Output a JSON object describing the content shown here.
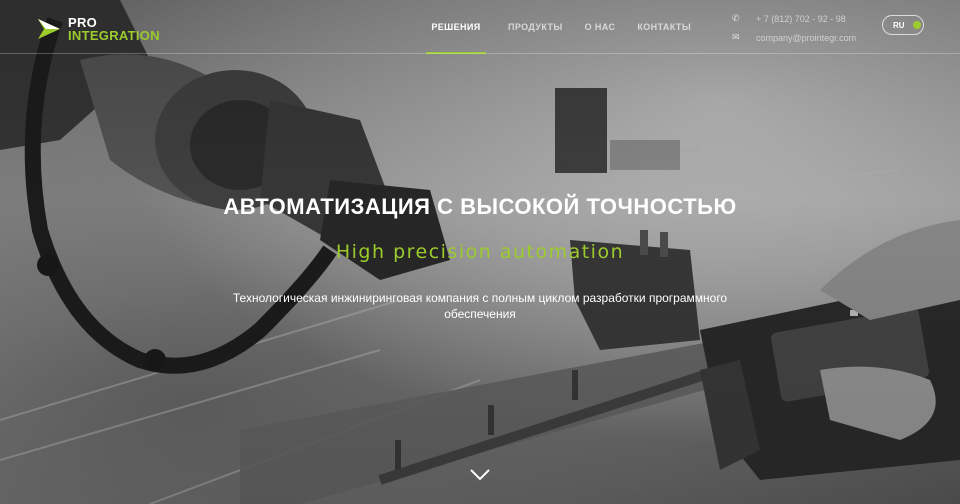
{
  "brand": {
    "name_line1": "PRO",
    "name_line2": "INTEGRATION",
    "accent_color": "#9ccc2c",
    "logo_icon": "arrow-logo-icon"
  },
  "nav": {
    "items": [
      {
        "label": "РЕШЕНИЯ",
        "active": true
      },
      {
        "label": "ПРОДУКТЫ",
        "active": false
      },
      {
        "label": "О НАС",
        "active": false
      },
      {
        "label": "КОНТАКТЫ",
        "active": false
      }
    ]
  },
  "contacts": {
    "phone": "+ 7 (812) 702 - 92 - 98",
    "phone_icon": "phone-icon",
    "email": "company@prointegr.com",
    "email_icon": "envelope-icon"
  },
  "language": {
    "current": "RU"
  },
  "hero": {
    "title": "АВТОМАТИЗАЦИЯ С ВЫСОКОЙ ТОЧНОСТЬЮ",
    "subtitle": "High precision automation",
    "description": "Технологическая инжиниринговая компания с полным циклом разработки программного обеспечения",
    "scroll_icon": "chevron-down-icon"
  }
}
